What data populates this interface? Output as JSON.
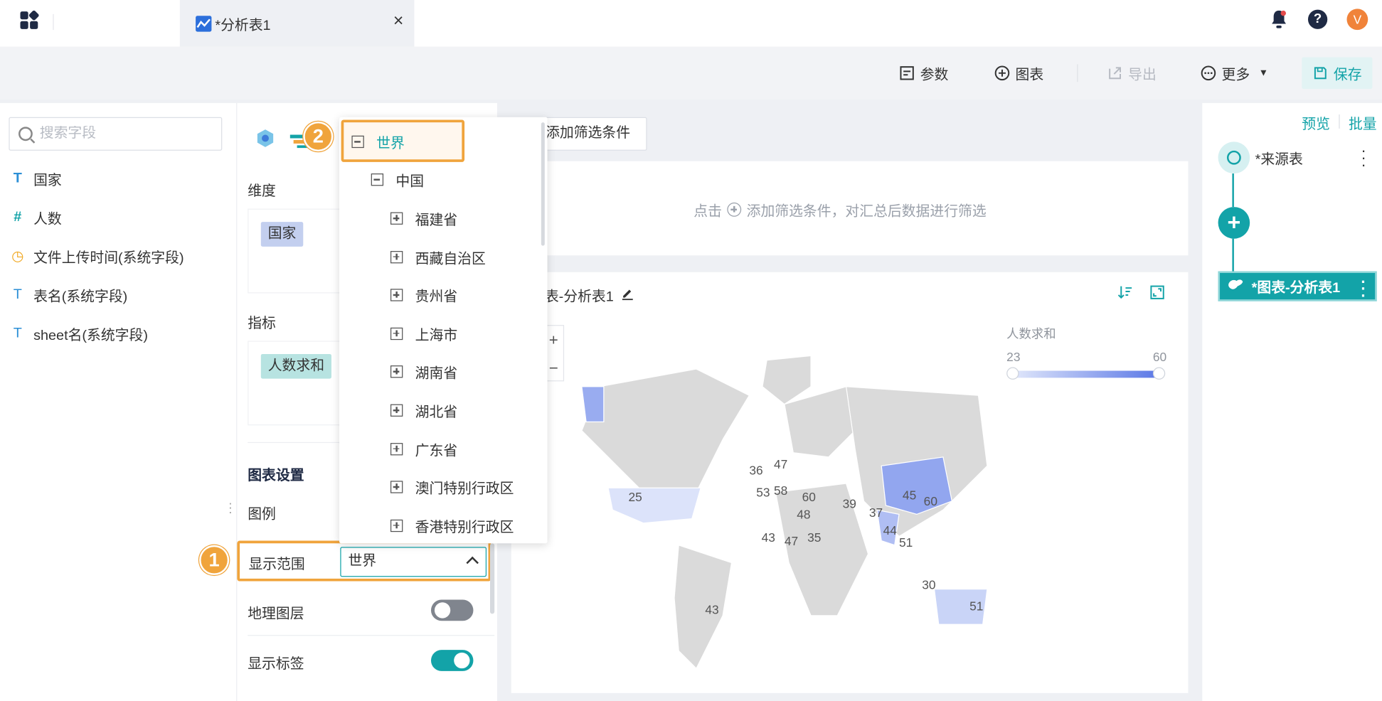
{
  "tab": {
    "title": "*分析表1",
    "close": "×"
  },
  "header": {
    "avatar_letter": "V"
  },
  "toolbar": {
    "params": "参数",
    "chart": "图表",
    "export": "导出",
    "more": "更多",
    "save": "保存"
  },
  "fields": {
    "search_placeholder": "搜索字段",
    "items": [
      {
        "type": "T",
        "label": "国家"
      },
      {
        "type": "#",
        "label": "人数"
      },
      {
        "type": "clock",
        "label": "文件上传时间(系统字段)"
      },
      {
        "type": "T",
        "label": "表名(系统字段)"
      },
      {
        "type": "T",
        "label": "sheet名(系统字段)"
      }
    ]
  },
  "config": {
    "dimension_label": "维度",
    "dimension_chip": "国家",
    "measure_label": "指标",
    "measure_chip": "人数求和",
    "settings_title": "图表设置",
    "legend_label": "图例",
    "range_label": "显示范围",
    "range_value": "世界",
    "geo_layer_label": "地理图层",
    "geo_layer_on": false,
    "show_label_label": "显示标签",
    "show_label_on": true
  },
  "badges": {
    "one": "1",
    "two": "2"
  },
  "tree": {
    "root": "世界",
    "country": "中国",
    "provinces": [
      "福建省",
      "西藏自治区",
      "贵州省",
      "上海市",
      "湖南省",
      "湖北省",
      "广东省",
      "澳门特别行政区",
      "香港特别行政区"
    ]
  },
  "filter": {
    "button": "添加筛选条件",
    "hint_prefix": "点击",
    "hint_suffix": "添加筛选条件，对汇总后数据进行筛选"
  },
  "chart": {
    "title": "表-分析表1",
    "legend_title": "人数求和",
    "legend_min": "23",
    "legend_max": "60",
    "zoom_in": "+",
    "zoom_out": "−"
  },
  "flow": {
    "preview": "预览",
    "batch": "批量",
    "source": "*来源表",
    "chart_node": "*图表-分析表1",
    "add": "+"
  },
  "chart_data": {
    "type": "map",
    "title": "表-分析表1",
    "measure": "人数求和",
    "range": [
      23,
      60
    ],
    "labels": [
      25,
      36,
      47,
      53,
      58,
      60,
      48,
      39,
      37,
      45,
      60,
      43,
      47,
      35,
      44,
      51,
      30,
      43,
      51
    ]
  },
  "colors": {
    "accent": "#13a3a8",
    "highlight": "#f0a43c",
    "map_low": "#e3e9fb",
    "map_high": "#5b78e6"
  }
}
